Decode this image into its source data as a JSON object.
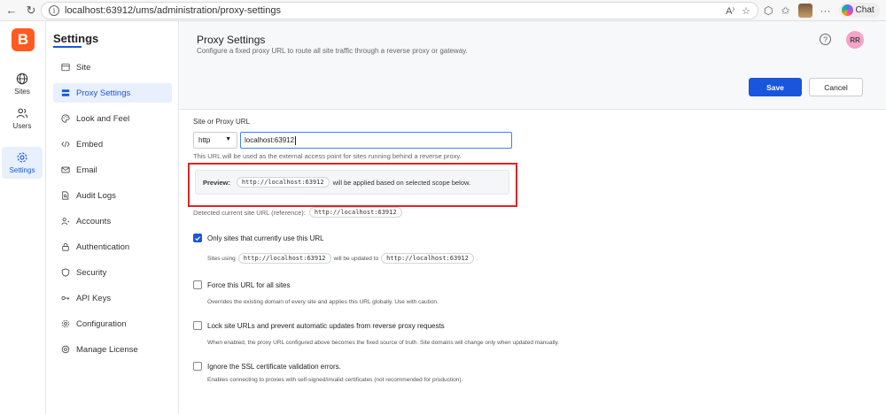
{
  "browser": {
    "url": "localhost:63912/ums/administration/proxy-settings",
    "chat_label": "Chat"
  },
  "rail": {
    "logo": "B",
    "items": [
      {
        "label": "Sites"
      },
      {
        "label": "Users"
      },
      {
        "label": "Settings"
      }
    ]
  },
  "sidebar": {
    "title": "Settings",
    "items": [
      {
        "label": "Site"
      },
      {
        "label": "Proxy Settings"
      },
      {
        "label": "Look and Feel"
      },
      {
        "label": "Embed"
      },
      {
        "label": "Email"
      },
      {
        "label": "Audit Logs"
      },
      {
        "label": "Accounts"
      },
      {
        "label": "Authentication"
      },
      {
        "label": "Security"
      },
      {
        "label": "API Keys"
      },
      {
        "label": "Configuration"
      },
      {
        "label": "Manage License"
      }
    ]
  },
  "header": {
    "title": "Proxy Settings",
    "subtitle": "Configure a fixed proxy URL to route all site traffic through a reverse proxy or gateway.",
    "help": "?",
    "avatar": "RR",
    "save_label": "Save",
    "cancel_label": "Cancel"
  },
  "form": {
    "field_label": "Site or Proxy URL",
    "protocol": "http",
    "url_value": "localhost:63912",
    "help_text": "This URL will be used as the external access point for sites running behind a reverse proxy.",
    "preview_label": "Preview:",
    "preview_url": "http://localhost:63912",
    "preview_suffix": "will be applied based on selected scope below.",
    "detected_label": "Detected current site URL (reference):",
    "detected_url": "http://localhost:63912"
  },
  "options": [
    {
      "label": "Only sites that currently use this URL",
      "checked": true
    },
    {
      "label": "Force this URL for all sites",
      "checked": false,
      "desc": "Overrides the existing domain of every site and applies this URL globally. Use with caution."
    },
    {
      "label": "Lock site URLs and prevent automatic updates from reverse proxy requests",
      "checked": false,
      "desc": "When enabled, the proxy URL configured above becomes the fixed source of truth. Site domains will change only when updated manually."
    },
    {
      "label": "Ignore the SSL certificate validation errors.",
      "checked": false,
      "desc": "Enables connecting to proxies with self-signed/invalid certificates (not recommended for production)."
    }
  ],
  "sites_using": {
    "prefix": "Sites using",
    "from_url": "http://localhost:63912",
    "middle": "will be updated to",
    "to_url": "http://localhost:63912",
    "suffix": "."
  },
  "colors": {
    "accent": "#1a56db",
    "logo": "#ff5a1f",
    "highlight": "#e02424",
    "avatar": "#f5a3c7"
  }
}
